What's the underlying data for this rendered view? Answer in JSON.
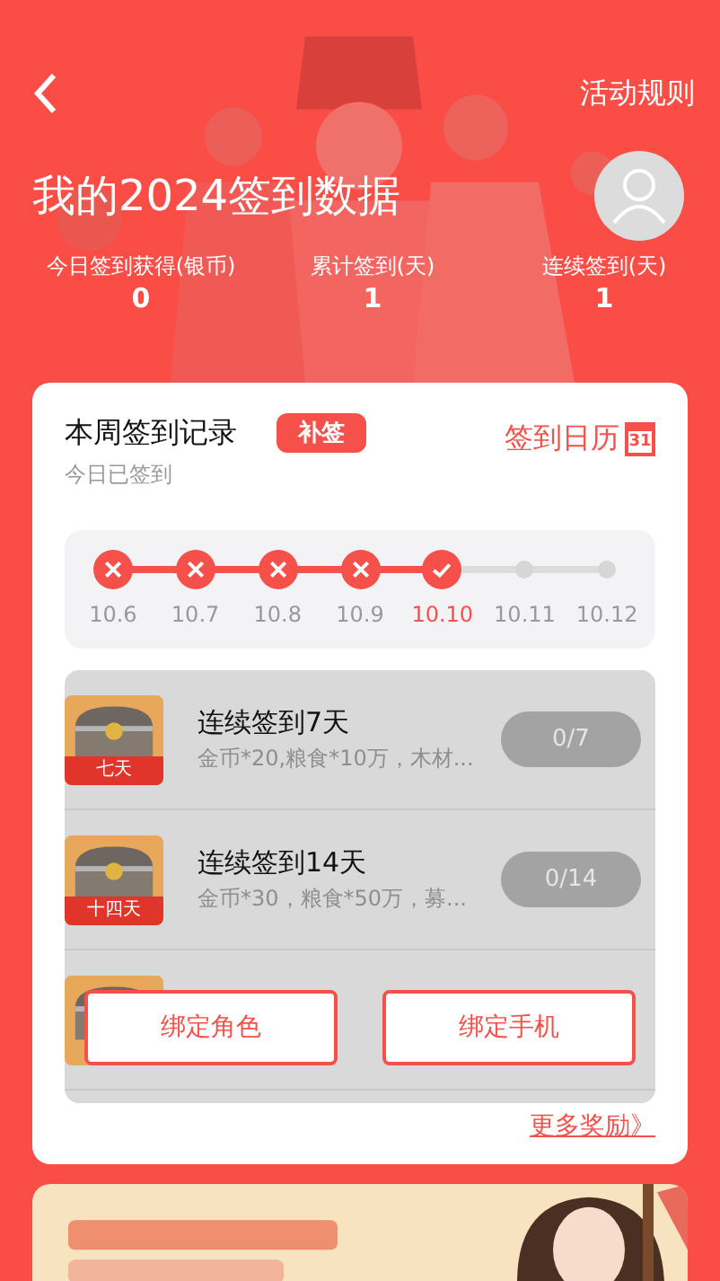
{
  "header": {
    "rules_link": "活动规则",
    "title": "我的2024签到数据",
    "stats": [
      {
        "label": "今日签到获得(银币)",
        "value": "0"
      },
      {
        "label": "累计签到(天)",
        "value": "1"
      },
      {
        "label": "连续签到(天)",
        "value": "1"
      }
    ]
  },
  "week": {
    "title": "本周签到记录",
    "makeup_button": "补签",
    "subtitle": "今日已签到",
    "calendar_link": "签到日历",
    "calendar_day": "31",
    "days": [
      {
        "date": "10.6",
        "kind": "missed",
        "today": false
      },
      {
        "date": "10.7",
        "kind": "missed",
        "today": false
      },
      {
        "date": "10.8",
        "kind": "missed",
        "today": false
      },
      {
        "date": "10.9",
        "kind": "missed",
        "today": false
      },
      {
        "date": "10.10",
        "kind": "signed",
        "today": true
      },
      {
        "date": "10.11",
        "kind": "future",
        "today": false
      },
      {
        "date": "10.12",
        "kind": "future",
        "today": false
      }
    ]
  },
  "rewards": [
    {
      "kind": "chest",
      "badge": "七天",
      "title": "连续签到7天",
      "desc": "金币*20,粮食*10万，木材...",
      "progress": "0/7"
    },
    {
      "kind": "chest",
      "badge": "十四天",
      "title": "连续签到14天",
      "desc": "金币*30，粮食*50万，募...",
      "progress": "0/14"
    },
    {
      "kind": "chest"
    }
  ],
  "overlay_buttons": [
    "绑定角色",
    "绑定手机"
  ],
  "more_link": "更多奖励》",
  "banner": {
    "kind": "picture"
  }
}
